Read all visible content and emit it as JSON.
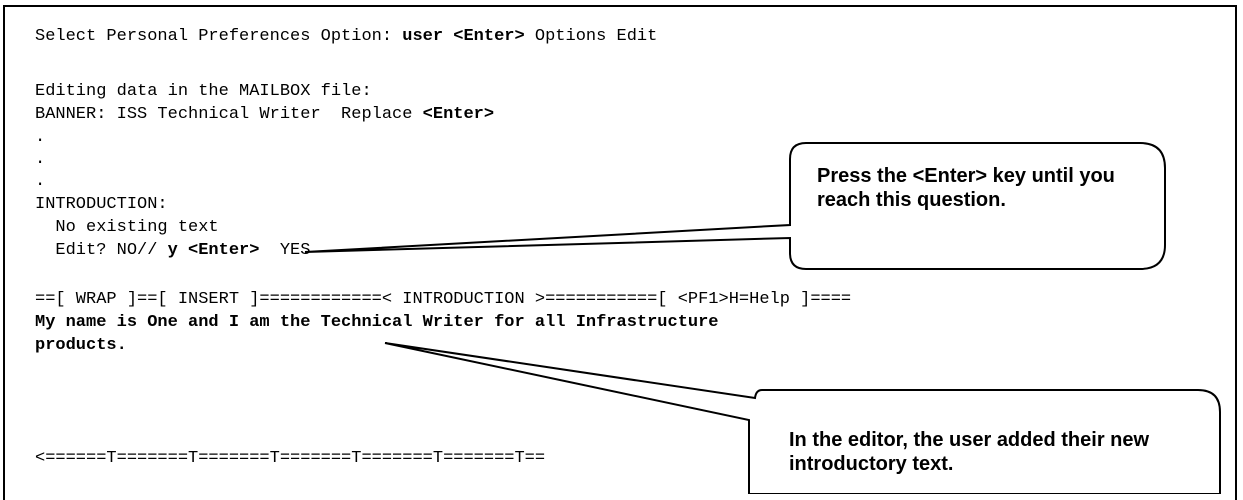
{
  "terminal": {
    "prompt_line": {
      "label": "Select Personal Preferences Option: ",
      "input": "user <Enter>",
      "rest": " Options Edit"
    },
    "editing_line": "Editing data in the MAILBOX file:",
    "banner_line": {
      "label": "BANNER: ISS Technical Writer  Replace ",
      "input": "<Enter>"
    },
    "dots": [
      ".",
      ".",
      "."
    ],
    "introduction_label": "INTRODUCTION:",
    "no_text_line": "  No existing text",
    "edit_line": {
      "label": "  Edit? NO// ",
      "input": "y <Enter>",
      "rest": "  YES"
    },
    "editor_header": "==[ WRAP ]==[ INSERT ]============< INTRODUCTION >===========[ <PF1>H=Help ]====",
    "editor_text_1": "My name is One and I am the Technical Writer for all Infrastructure",
    "editor_text_2": "products.",
    "ruler": "<======T=======T=======T=======T=======T=======T=="
  },
  "callouts": {
    "enter_key": "Press the <Enter> key until you reach this question.",
    "editor": "In the editor, the user added their new introductory text."
  }
}
